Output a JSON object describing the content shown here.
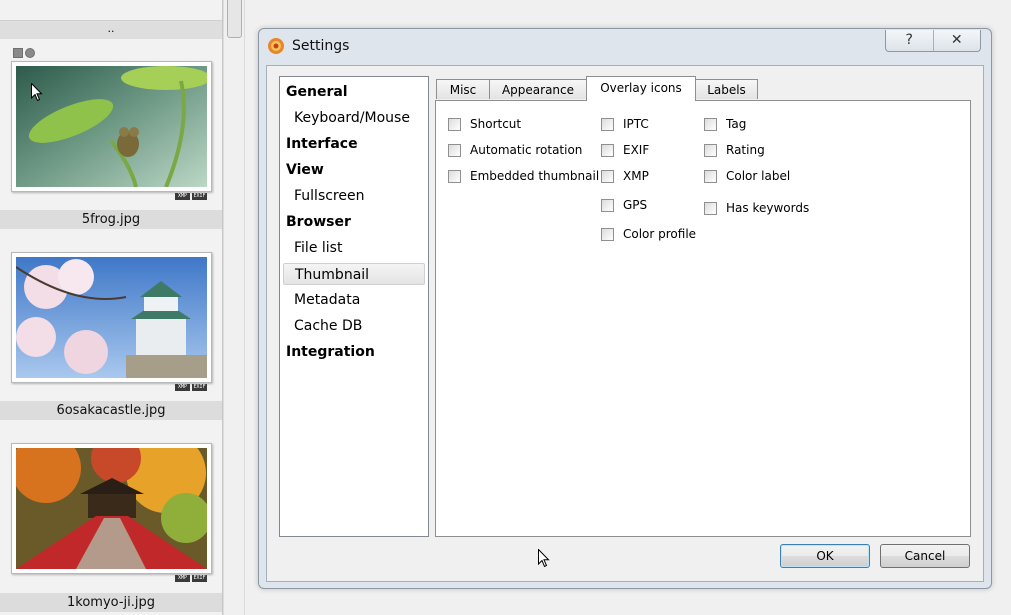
{
  "browser": {
    "parent_dir_label": "..",
    "files": [
      {
        "name": "5frog.jpg",
        "badges": [
          "XMP",
          "EXIF"
        ]
      },
      {
        "name": "6osakacastle.jpg",
        "badges": [
          "XMP",
          "EXIF"
        ]
      },
      {
        "name": "1komyo-ji.jpg",
        "badges": [
          "XMP",
          "EXIF"
        ]
      }
    ]
  },
  "dialog": {
    "title": "Settings",
    "help_label": "?",
    "close_label": "✕",
    "categories": [
      {
        "label": "General",
        "level": "header"
      },
      {
        "label": "Keyboard/Mouse",
        "level": "sub"
      },
      {
        "label": "Interface",
        "level": "header"
      },
      {
        "label": "View",
        "level": "header"
      },
      {
        "label": "Fullscreen",
        "level": "sub"
      },
      {
        "label": "Browser",
        "level": "header"
      },
      {
        "label": "File list",
        "level": "sub"
      },
      {
        "label": "Thumbnail",
        "level": "sub",
        "selected": true
      },
      {
        "label": "Metadata",
        "level": "sub"
      },
      {
        "label": "Cache DB",
        "level": "sub"
      },
      {
        "label": "Integration",
        "level": "header"
      }
    ],
    "tabs": [
      {
        "label": "Misc"
      },
      {
        "label": "Appearance"
      },
      {
        "label": "Overlay icons",
        "active": true
      },
      {
        "label": "Labels"
      }
    ],
    "overlay_options": {
      "col1": [
        {
          "label": "Shortcut",
          "checked": false
        },
        {
          "label": "Automatic rotation",
          "checked": false
        },
        {
          "label": "Embedded thumbnail",
          "checked": false
        }
      ],
      "col2": [
        {
          "label": "IPTC",
          "checked": false
        },
        {
          "label": "EXIF",
          "checked": false
        },
        {
          "label": "XMP",
          "checked": false
        },
        {
          "label": "GPS",
          "checked": false
        },
        {
          "label": "Color profile",
          "checked": false
        }
      ],
      "col3": [
        {
          "label": "Tag",
          "checked": false
        },
        {
          "label": "Rating",
          "checked": false
        },
        {
          "label": "Color label",
          "checked": false
        },
        {
          "label": "Has keywords",
          "checked": false
        }
      ]
    },
    "ok_label": "OK",
    "cancel_label": "Cancel"
  },
  "colors": {
    "dialog_frame": "#dfe5ec",
    "selected_item": "#e4e4e4",
    "default_button_border": "#3c7fb1"
  }
}
